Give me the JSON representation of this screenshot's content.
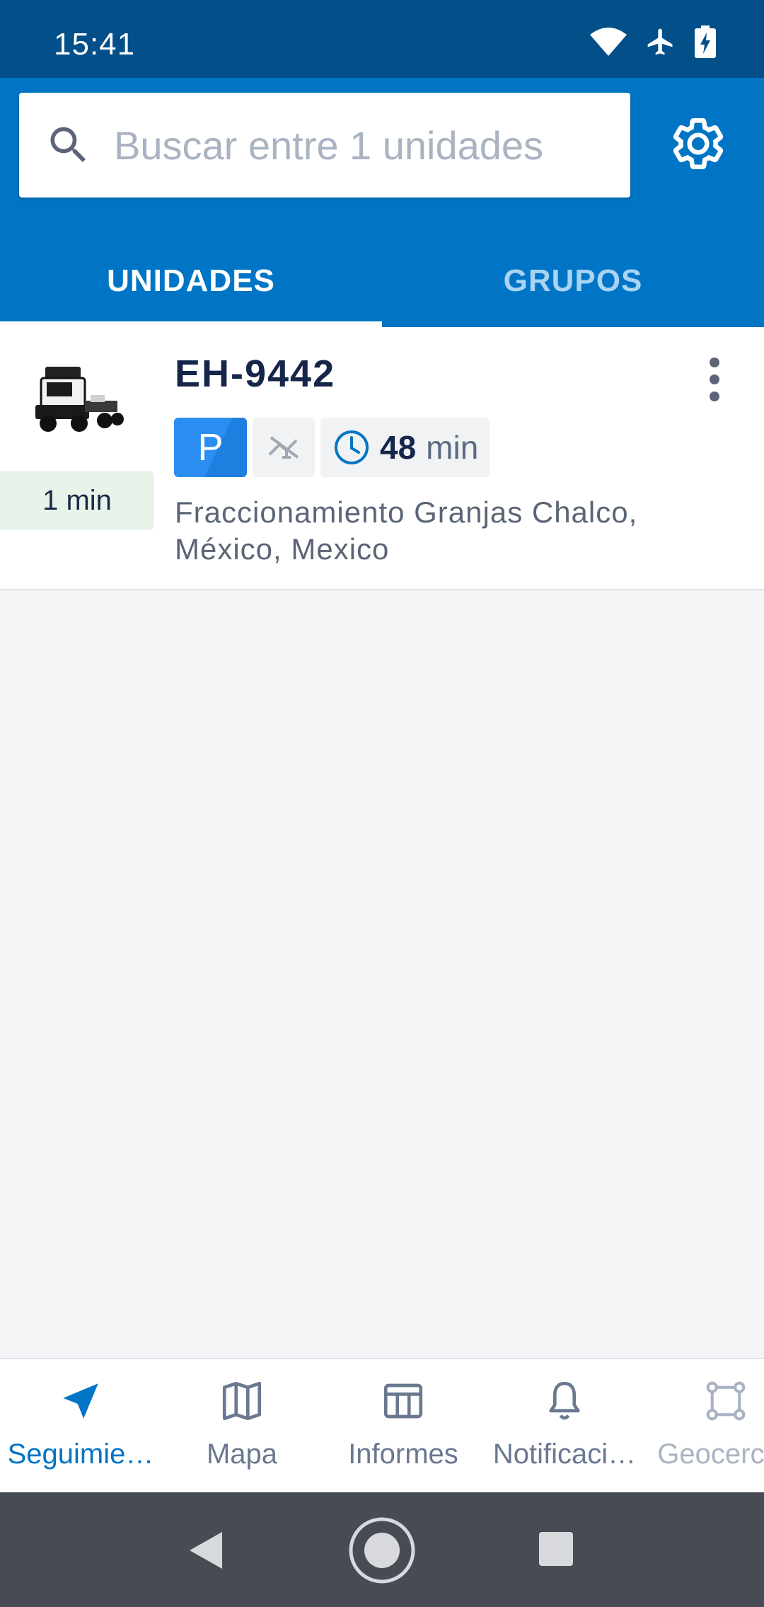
{
  "status_bar": {
    "time": "15:41",
    "icons": [
      "wifi-icon",
      "airplane-mode-icon",
      "battery-charging-icon"
    ]
  },
  "search": {
    "placeholder": "Buscar entre 1 unidades",
    "value": "",
    "icon": "search-icon"
  },
  "settings": {
    "icon": "gear-icon"
  },
  "tabs": [
    {
      "label": "UNIDADES",
      "selected": true
    },
    {
      "label": "GRUPOS",
      "selected": false
    }
  ],
  "units": [
    {
      "name": "EH-9442",
      "image": "truck-icon",
      "last_update": "1 min",
      "state_badge": "P",
      "connection_icon": "no-connection-icon",
      "duration_value": "48",
      "duration_unit": "min",
      "address": "Fraccionamiento Granjas Chalco, México, Mexico",
      "menu_icon": "more-vertical-icon"
    }
  ],
  "bottom_nav": [
    {
      "label": "Seguimie…",
      "icon": "navigation-arrow-icon",
      "active": true
    },
    {
      "label": "Mapa",
      "icon": "map-icon",
      "active": false
    },
    {
      "label": "Informes",
      "icon": "table-icon",
      "active": false
    },
    {
      "label": "Notificaci…",
      "icon": "bell-icon",
      "active": false
    },
    {
      "label": "Geocercas",
      "icon": "geofence-icon",
      "active": false
    }
  ],
  "colors": {
    "status_bar": "#024f89",
    "header": "#0075c5",
    "accent": "#0075c5",
    "parking_badge": "#2c8ef0",
    "update_badge_bg": "#e8f4e9",
    "system_nav": "#474c54"
  }
}
